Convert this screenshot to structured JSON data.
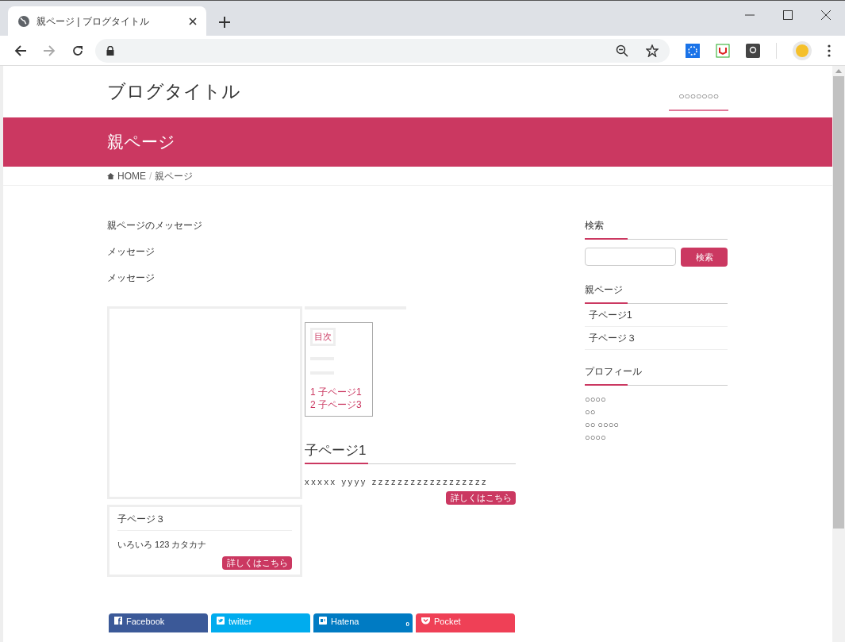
{
  "browser": {
    "tab_title": "親ページ | ブログタイトル"
  },
  "header": {
    "title": "ブログタイトル",
    "nav_item": "○○○○○○○"
  },
  "banner": {
    "title": "親ページ"
  },
  "breadcrumb": [
    "HOME",
    "親ページ"
  ],
  "breadcrumb_separator": "/",
  "messages": [
    "親ページのメッセージ",
    "メッセージ",
    "メッセージ"
  ],
  "toc": {
    "title": "目次",
    "items": [
      {
        "number": "1",
        "label": "子ページ1"
      },
      {
        "number": "2",
        "label": "子ページ3"
      }
    ]
  },
  "section": {
    "heading": "子ページ1",
    "text": "xxxxx yyyy zzzzzzzzzzzzzzzzzz",
    "button": "詳しくはこちら"
  },
  "card": {
    "title": "子ページ３",
    "text": "いろいろ 123 カタカナ",
    "button": "詳しくはこちら"
  },
  "sidebar": {
    "search": {
      "title": "検索",
      "button": "検索"
    },
    "pages": {
      "title": "親ページ",
      "items": [
        "子ページ1",
        "子ページ３"
      ]
    },
    "profile": {
      "title": "プロフィール",
      "lines": [
        "○○○○",
        "○○",
        "○○ ○○○○",
        "○○○○"
      ]
    }
  },
  "share": [
    {
      "kind": "facebook",
      "label": "Facebook"
    },
    {
      "kind": "twitter",
      "label": "twitter"
    },
    {
      "kind": "hatena",
      "label": "Hatena",
      "count": "0"
    },
    {
      "kind": "pocket",
      "label": "Pocket"
    }
  ]
}
